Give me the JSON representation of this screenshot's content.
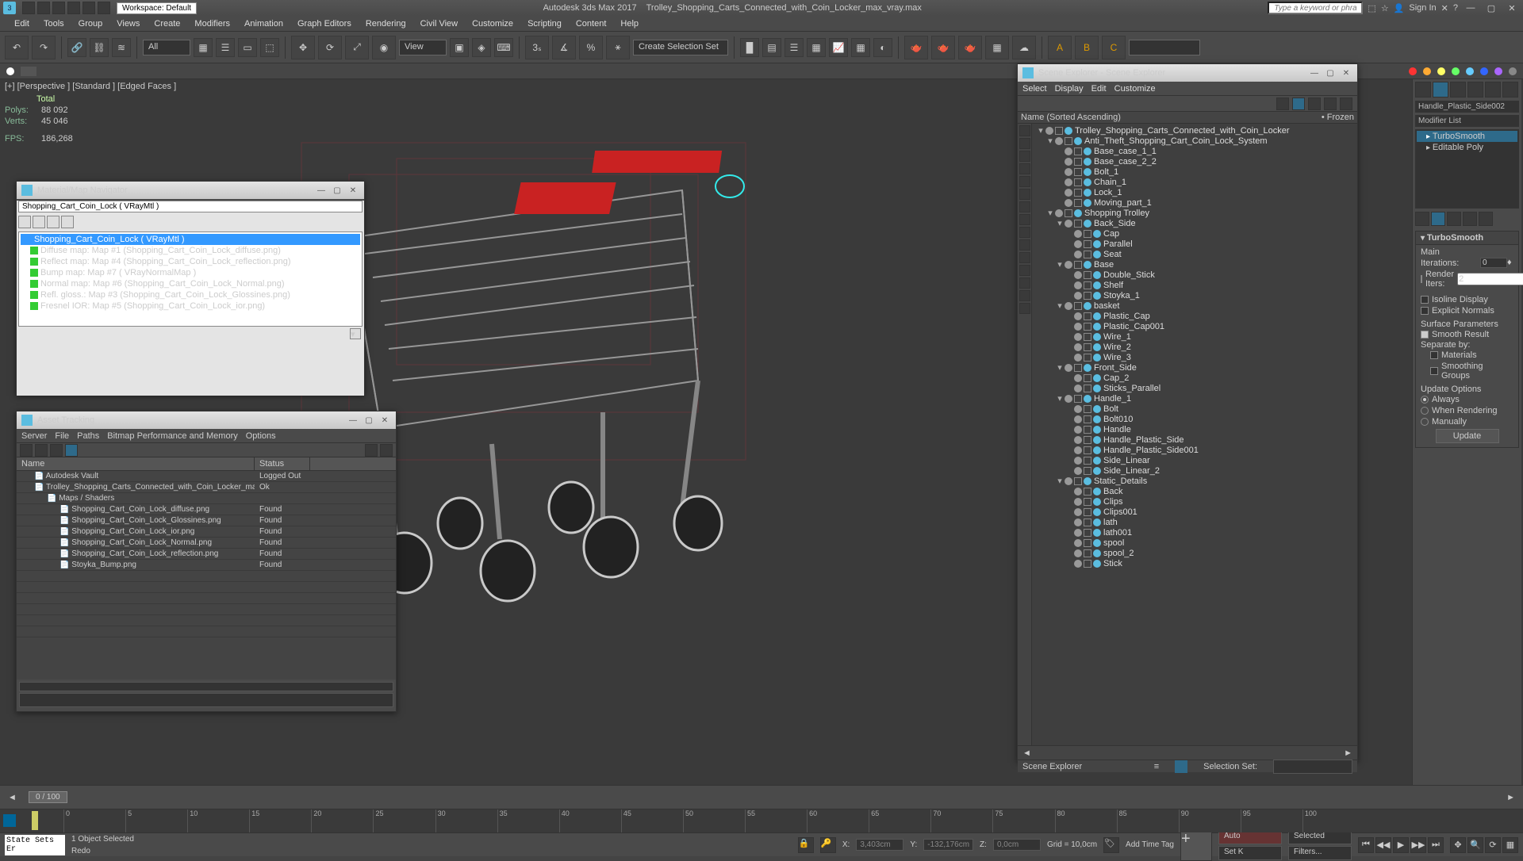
{
  "titlebar": {
    "workspace_label": "Workspace: Default",
    "app": "Autodesk 3ds Max 2017",
    "file": "Trolley_Shopping_Carts_Connected_with_Coin_Locker_max_vray.max",
    "search_placeholder": "Type a keyword or phrase",
    "sign_in": "Sign In"
  },
  "menubar": [
    "Edit",
    "Tools",
    "Group",
    "Views",
    "Create",
    "Modifiers",
    "Animation",
    "Graph Editors",
    "Rendering",
    "Civil View",
    "Customize",
    "Scripting",
    "Content",
    "Help"
  ],
  "main_toolbar": {
    "filter": "All",
    "view": "View",
    "named_sel": "Create Selection Set"
  },
  "viewport": {
    "labels": "[+] [Perspective ]  [Standard ]  [Edged Faces ]",
    "stats_total": "Total",
    "polys_label": "Polys:",
    "polys": "88 092",
    "verts_label": "Verts:",
    "verts": "45 046",
    "fps_label": "FPS:",
    "fps": "186,268"
  },
  "material_nav": {
    "title": "Material/Map Navigator",
    "path": "Shopping_Cart_Coin_Lock  ( VRayMtl )",
    "root": "Shopping_Cart_Coin_Lock  ( VRayMtl )",
    "children": [
      "Diffuse map: Map #1 (Shopping_Cart_Coin_Lock_diffuse.png)",
      "Reflect map: Map #4 (Shopping_Cart_Coin_Lock_reflection.png)",
      "Bump map: Map #7  ( VRayNormalMap )",
      "Normal map: Map #6 (Shopping_Cart_Coin_Lock_Normal.png)",
      "Refl. gloss.: Map #3 (Shopping_Cart_Coin_Lock_Glossines.png)",
      "Fresnel IOR: Map #5 (Shopping_Cart_Coin_Lock_ior.png)"
    ]
  },
  "asset_tracking": {
    "title": "Asset Tracking",
    "menus": [
      "Server",
      "File",
      "Paths",
      "Bitmap Performance and Memory",
      "Options"
    ],
    "cols": [
      "Name",
      "Status"
    ],
    "rows": [
      {
        "name": "Autodesk Vault",
        "status": "Logged Out",
        "indent": 1
      },
      {
        "name": "Trolley_Shopping_Carts_Connected_with_Coin_Locker_max_vra…",
        "status": "Ok",
        "indent": 1
      },
      {
        "name": "Maps / Shaders",
        "status": "",
        "indent": 2
      },
      {
        "name": "Shopping_Cart_Coin_Lock_diffuse.png",
        "status": "Found",
        "indent": 3
      },
      {
        "name": "Shopping_Cart_Coin_Lock_Glossines.png",
        "status": "Found",
        "indent": 3
      },
      {
        "name": "Shopping_Cart_Coin_Lock_ior.png",
        "status": "Found",
        "indent": 3
      },
      {
        "name": "Shopping_Cart_Coin_Lock_Normal.png",
        "status": "Found",
        "indent": 3
      },
      {
        "name": "Shopping_Cart_Coin_Lock_reflection.png",
        "status": "Found",
        "indent": 3
      },
      {
        "name": "Stoyka_Bump.png",
        "status": "Found",
        "indent": 3
      }
    ]
  },
  "scene_explorer": {
    "title": "Scene Explorer - Scene Explorer",
    "menus": [
      "Select",
      "Display",
      "Edit",
      "Customize"
    ],
    "col_name": "Name (Sorted Ascending)",
    "col_frozen": "• Frozen",
    "footer": "Scene Explorer",
    "selset_label": "Selection Set:",
    "tree": [
      {
        "d": 0,
        "t": "▾",
        "n": "Trolley_Shopping_Carts_Connected_with_Coin_Locker"
      },
      {
        "d": 1,
        "t": "▾",
        "n": "Anti_Theft_Shopping_Cart_Coin_Lock_System"
      },
      {
        "d": 2,
        "t": "",
        "n": "Base_case_1_1"
      },
      {
        "d": 2,
        "t": "",
        "n": "Base_case_2_2"
      },
      {
        "d": 2,
        "t": "",
        "n": "Bolt_1"
      },
      {
        "d": 2,
        "t": "",
        "n": "Chain_1"
      },
      {
        "d": 2,
        "t": "",
        "n": "Lock_1"
      },
      {
        "d": 2,
        "t": "",
        "n": "Moving_part_1"
      },
      {
        "d": 1,
        "t": "▾",
        "n": "Shopping Trolley"
      },
      {
        "d": 2,
        "t": "▾",
        "n": "Back_Side"
      },
      {
        "d": 3,
        "t": "",
        "n": "Cap"
      },
      {
        "d": 3,
        "t": "",
        "n": "Parallel"
      },
      {
        "d": 3,
        "t": "",
        "n": "Seat"
      },
      {
        "d": 2,
        "t": "▾",
        "n": "Base"
      },
      {
        "d": 3,
        "t": "",
        "n": "Double_Stick"
      },
      {
        "d": 3,
        "t": "",
        "n": "Shelf"
      },
      {
        "d": 3,
        "t": "",
        "n": "Stoyka_1"
      },
      {
        "d": 2,
        "t": "▾",
        "n": "basket"
      },
      {
        "d": 3,
        "t": "",
        "n": "Plastic_Cap"
      },
      {
        "d": 3,
        "t": "",
        "n": "Plastic_Cap001"
      },
      {
        "d": 3,
        "t": "",
        "n": "Wire_1"
      },
      {
        "d": 3,
        "t": "",
        "n": "Wire_2"
      },
      {
        "d": 3,
        "t": "",
        "n": "Wire_3"
      },
      {
        "d": 2,
        "t": "▾",
        "n": "Front_Side"
      },
      {
        "d": 3,
        "t": "",
        "n": "Cap_2"
      },
      {
        "d": 3,
        "t": "",
        "n": "Sticks_Parallel"
      },
      {
        "d": 2,
        "t": "▾",
        "n": "Handle_1"
      },
      {
        "d": 3,
        "t": "",
        "n": "Bolt"
      },
      {
        "d": 3,
        "t": "",
        "n": "Bolt010"
      },
      {
        "d": 3,
        "t": "",
        "n": "Handle"
      },
      {
        "d": 3,
        "t": "",
        "n": "Handle_Plastic_Side"
      },
      {
        "d": 3,
        "t": "",
        "n": "Handle_Plastic_Side001"
      },
      {
        "d": 3,
        "t": "",
        "n": "Side_Linear"
      },
      {
        "d": 3,
        "t": "",
        "n": "Side_Linear_2"
      },
      {
        "d": 2,
        "t": "▾",
        "n": "Static_Details"
      },
      {
        "d": 3,
        "t": "",
        "n": "Back"
      },
      {
        "d": 3,
        "t": "",
        "n": "Clips"
      },
      {
        "d": 3,
        "t": "",
        "n": "Clips001"
      },
      {
        "d": 3,
        "t": "",
        "n": "lath"
      },
      {
        "d": 3,
        "t": "",
        "n": "lath001"
      },
      {
        "d": 3,
        "t": "",
        "n": "spool"
      },
      {
        "d": 3,
        "t": "",
        "n": "spool_2"
      },
      {
        "d": 3,
        "t": "",
        "n": "Stick"
      }
    ]
  },
  "command_panel": {
    "obj_name": "Handle_Plastic_Side002",
    "mod_list": "Modifier List",
    "stack": [
      "TurboSmooth",
      "Editable Poly"
    ],
    "rollout_title": "TurboSmooth",
    "main_label": "Main",
    "iterations_label": "Iterations:",
    "iterations": "0",
    "render_iters_label": "Render Iters:",
    "render_iters": "2",
    "isoline": "Isoline Display",
    "explicit": "Explicit Normals",
    "surf_params": "Surface Parameters",
    "smooth_result": "Smooth Result",
    "separate_by": "Separate by:",
    "materials": "Materials",
    "smoothing_groups": "Smoothing Groups",
    "update_options": "Update Options",
    "always": "Always",
    "when_rendering": "When Rendering",
    "manually": "Manually",
    "update_btn": "Update"
  },
  "timeline": {
    "slider": "0 / 100",
    "ticks": [
      "0",
      "5",
      "10",
      "15",
      "20",
      "25",
      "30",
      "35",
      "40",
      "45",
      "50",
      "55",
      "60",
      "65",
      "70",
      "75",
      "80",
      "85",
      "90",
      "95",
      "100"
    ],
    "ss": "State Sets Er",
    "sel_status": "1 Object Selected",
    "redo": "Redo",
    "x_label": "X:",
    "x": "3,403cm",
    "y_label": "Y:",
    "y": "-132,176cm",
    "z_label": "Z:",
    "z": "0,0cm",
    "grid": "Grid = 10,0cm",
    "add_time_tag": "Add Time Tag",
    "auto": "Auto",
    "setk": "Set K",
    "selected": "Selected",
    "filters": "Filters..."
  }
}
